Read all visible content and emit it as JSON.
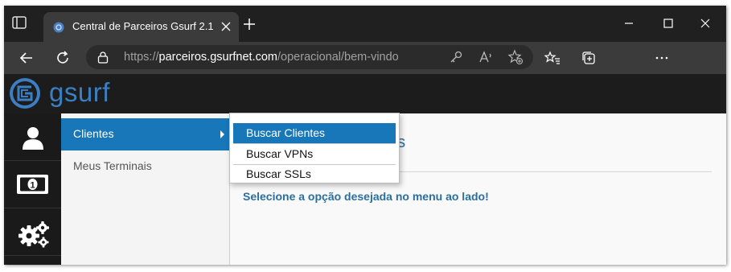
{
  "browser": {
    "tab_title": "Central de Parceiros Gsurf 2.1",
    "url_scheme": "https://",
    "url_host": "parceiros.gsurfnet.com",
    "url_path": "/operacional/bem-vindo",
    "icons": [
      "tab-actions-icon",
      "favicon-icon",
      "close-tab-icon",
      "new-tab-icon",
      "minimize-icon",
      "maximize-icon",
      "close-window-icon",
      "back-icon",
      "refresh-icon",
      "lock-icon",
      "key-icon",
      "read-aloud-icon",
      "add-favorite-icon",
      "favorites-icon",
      "collections-icon",
      "more-icon"
    ]
  },
  "site": {
    "logo_text": "gsurf",
    "brand_color": "#3b7fc2",
    "accent_color": "#1877b8"
  },
  "rail": {
    "icons": [
      "user-icon",
      "money-icon",
      "gears-icon"
    ]
  },
  "menu": {
    "items": [
      {
        "label": "Clientes",
        "active": true
      },
      {
        "label": "Meus Terminais",
        "active": false
      }
    ]
  },
  "submenu": {
    "items": [
      {
        "label": "Buscar Clientes",
        "active": true
      },
      {
        "label": "Buscar VPNs",
        "active": false
      },
      {
        "label": "Buscar SSLs",
        "active": false
      }
    ]
  },
  "content": {
    "title_visible_tail": "os",
    "lead": "Selecione a opção desejada no menu ao lado!"
  }
}
